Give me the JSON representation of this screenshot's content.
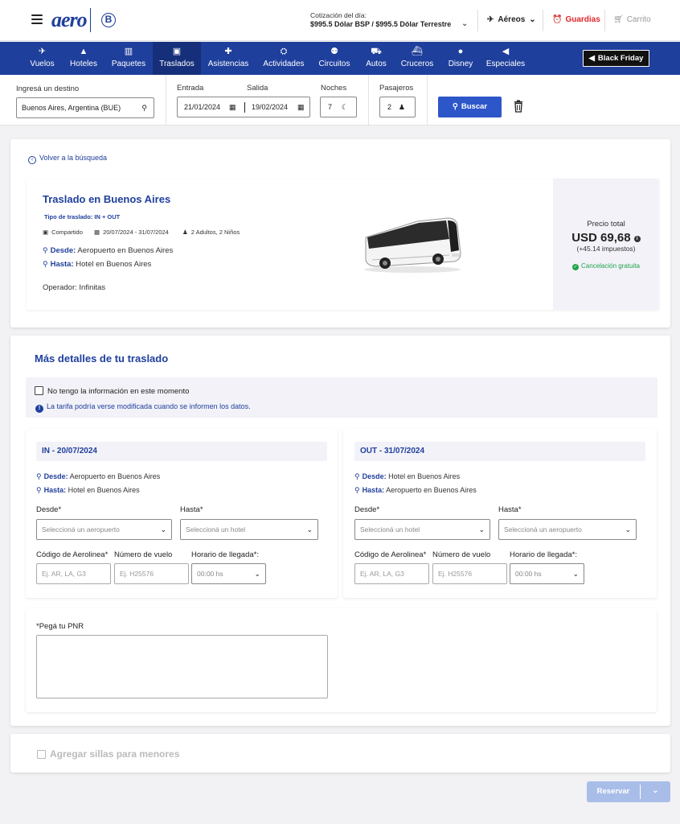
{
  "header": {
    "logo_text": "aero",
    "badge_letter": "B",
    "cotizacion_label": "Cotización del día:",
    "cotizacion_value": "$995.5 Dólar BSP / $995.5 Dólar Terrestre",
    "aereos_label": "Aéreos",
    "guardias_label": "Guardias",
    "carrito_label": "Carrito"
  },
  "nav": {
    "items": [
      {
        "label": "Vuelos",
        "icon": "plane-icon"
      },
      {
        "label": "Hoteles",
        "icon": "hotel-icon"
      },
      {
        "label": "Paquetes",
        "icon": "suitcase-icon"
      },
      {
        "label": "Traslados",
        "icon": "bus-icon",
        "active": true
      },
      {
        "label": "Asistencias",
        "icon": "medkit-icon"
      },
      {
        "label": "Actividades",
        "icon": "activity-icon"
      },
      {
        "label": "Circuitos",
        "icon": "circuit-icon"
      },
      {
        "label": "Autos",
        "icon": "car-icon"
      },
      {
        "label": "Cruceros",
        "icon": "ship-icon"
      },
      {
        "label": "Disney",
        "icon": "mouse-icon"
      },
      {
        "label": "Especiales",
        "icon": "megaphone-icon"
      }
    ],
    "black_friday_label": "Black Friday"
  },
  "search": {
    "destino_label": "Ingresá un destino",
    "destino_value": "Buenos Aires, Argentina (BUE)",
    "entrada_label": "Entrada",
    "entrada_value": "21/01/2024",
    "salida_label": "Salida",
    "salida_value": "19/02/2024",
    "noches_label": "Noches",
    "noches_value": "7",
    "pasajeros_label": "Pasajeros",
    "pasajeros_value": "2",
    "buscar_label": "Buscar"
  },
  "result": {
    "back_label": "Volver a la búsqueda",
    "title": "Traslado en Buenos Aires",
    "tipo": "Tipo de traslado: IN + OUT",
    "modalidad": "Compartido",
    "fechas": "20/07/2024 - 31/07/2024",
    "pasajeros": "2 Adultos, 2 Niños",
    "desde_label": "Desde:",
    "desde_value": "Aeropuerto en Buenos Aires",
    "hasta_label": "Hasta:",
    "hasta_value": "Hotel en Buenos Aires",
    "operador_label": "Operador:",
    "operador_value": "Infinitas",
    "precio_label": "Precio total",
    "precio_value": "USD 69,68",
    "impuestos": "(+45.14 impuestos)",
    "cancelacion": "Cancelación gratuita"
  },
  "details": {
    "title": "Más detalles de tu traslado",
    "no_info_label": "No tengo la información en este momento",
    "warning": "La tarifa podría verse modificada cuando se informen los datos.",
    "legs": [
      {
        "head": "IN - 20/07/2024",
        "desde_label": "Desde:",
        "desde_value": "Aeropuerto en Buenos Aires",
        "hasta_label": "Hasta:",
        "hasta_value": "Hotel en Buenos Aires",
        "desde_field_label": "Desde*",
        "desde_placeholder": "Seleccioná un aeropuerto",
        "hasta_field_label": "Hasta*",
        "hasta_placeholder": "Seleccioná un hotel",
        "aerolinea_label": "Código de Aerolinea*",
        "aerolinea_placeholder": "Ej. AR, LA, G3",
        "vuelo_label": "Número de vuelo",
        "vuelo_placeholder": "Ej. H25576",
        "horario_label": "Horario de llegada*:",
        "horario_placeholder": "00:00 hs"
      },
      {
        "head": "OUT - 31/07/2024",
        "desde_label": "Desde:",
        "desde_value": "Hotel en Buenos Aires",
        "hasta_label": "Hasta:",
        "hasta_value": "Aeropuerto en Buenos Aires",
        "desde_field_label": "Desde*",
        "desde_placeholder": "Seleccioná un hotel",
        "hasta_field_label": "Hasta*",
        "hasta_placeholder": "Seleccioná un aeropuerto",
        "aerolinea_label": "Código de Aerolinea*",
        "aerolinea_placeholder": "Ej. AR, LA, G3",
        "vuelo_label": "Número de vuelo",
        "vuelo_placeholder": "Ej. H25576",
        "horario_label": "Horario de llegada*:",
        "horario_placeholder": "00:00 hs"
      }
    ],
    "pnr_label": "*Pegá tu PNR"
  },
  "sillas_label": "Agregar sillas para menores",
  "reservar_label": "Reservar",
  "colors": {
    "primary": "#1f3f9c",
    "button": "#2d56c9",
    "danger": "#e0262b",
    "success": "#22a34a",
    "disabled": "#a9bde9"
  }
}
